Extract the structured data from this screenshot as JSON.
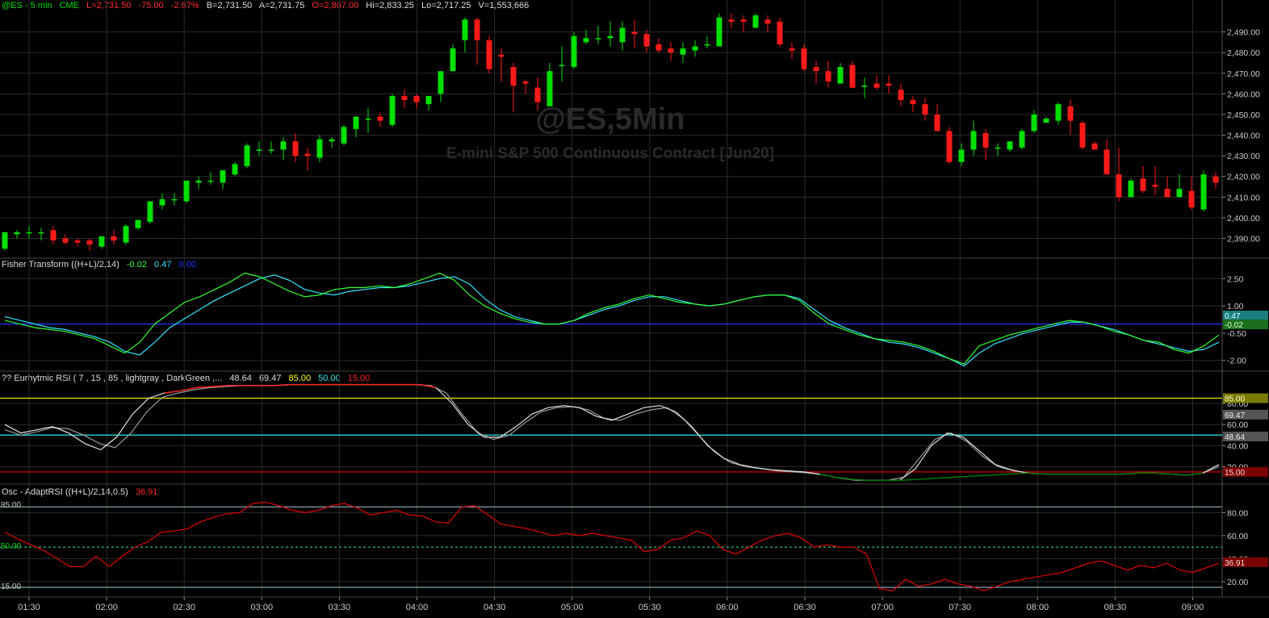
{
  "header": {
    "symbol": "@ES - 5 min",
    "exchange": "CME",
    "last": "L=2,731.50",
    "change": "-75.00",
    "change_pct": "-2.67%",
    "bid": "B=2,731.50",
    "ask": "A=2,731.75",
    "open": "O=2,807.00",
    "high": "Hi=2,833.25",
    "low": "Lo=2,717.25",
    "volume": "V=1,553,666"
  },
  "watermark": {
    "symbol": "@ES,5Min",
    "description": "E-mini S&P 500 Continuous Contract [Jun20]"
  },
  "panes": {
    "fisher": {
      "title": "Fisher Transform ((H+L)/2,14)",
      "v1": "-0.02",
      "v2": "0.47",
      "v3": "0.00"
    },
    "rsi": {
      "title": "?? Eurhytmic RSI ( 7 , 15 , 85 , lightgray , DarkGreen ,...",
      "v1": "48.64",
      "v2": "69.47",
      "v3": "85.00",
      "v4": "50.00",
      "v5": "15.00"
    },
    "osc": {
      "title": "Osc - AdaptRSI ((H+L)/2,14,0.5)",
      "v1": "36.91",
      "lvl_hi": "85.00",
      "lvl_mid": "50.00",
      "lvl_lo": "15.00"
    }
  },
  "colors": {
    "up": "#00e000",
    "down": "#ff1a1a",
    "fisher_a": "#33ff33",
    "fisher_b": "#33e6ff",
    "zero": "#2233ff",
    "rsi_fast": "#e0e0e0",
    "rsi_slow": "#9a9a9a",
    "rsi_red": "#ff1a1a",
    "rsi_green": "#007700",
    "band85": "#d6d600",
    "band50": "#33e6e6",
    "band15": "#c40000",
    "osc": "#e00000"
  },
  "chart_data": [
    {
      "type": "candlestick",
      "title": "@ES - 5 min",
      "x": [
        "01:30",
        "02:00",
        "02:30",
        "03:00",
        "03:30",
        "04:00",
        "04:30",
        "05:00",
        "05:30",
        "06:00",
        "06:30",
        "07:00",
        "07:30",
        "08:00",
        "08:30",
        "09:00"
      ],
      "ylim": [
        2382,
        2500
      ],
      "yticks": [
        2390,
        2400,
        2410,
        2420,
        2430,
        2440,
        2450,
        2460,
        2470,
        2480,
        2490
      ],
      "ytick_labels": [
        "2,390.00",
        "2,400.00",
        "2,410.00",
        "2,420.00",
        "2,430.00",
        "2,440.00",
        "2,450.00",
        "2,460.00",
        "2,470.00",
        "2,480.00",
        "2,490.00"
      ],
      "candles": [
        [
          2385,
          2393,
          2384,
          2393
        ],
        [
          2392,
          2394,
          2390,
          2393
        ],
        [
          2393,
          2396,
          2390,
          2393
        ],
        [
          2393,
          2395,
          2389,
          2393
        ],
        [
          2394,
          2396,
          2387,
          2389
        ],
        [
          2390,
          2392,
          2387,
          2388
        ],
        [
          2389,
          2390,
          2386,
          2388
        ],
        [
          2389,
          2390,
          2384,
          2387
        ],
        [
          2386,
          2391,
          2385,
          2391
        ],
        [
          2391,
          2394,
          2387,
          2389
        ],
        [
          2388,
          2397,
          2387,
          2396
        ],
        [
          2395,
          2399,
          2394,
          2399
        ],
        [
          2398,
          2408,
          2397,
          2408
        ],
        [
          2406,
          2412,
          2404,
          2409
        ],
        [
          2409,
          2412,
          2406,
          2409
        ],
        [
          2408,
          2418,
          2407,
          2418
        ],
        [
          2417,
          2420,
          2414,
          2418
        ],
        [
          2418,
          2422,
          2416,
          2418
        ],
        [
          2417,
          2423,
          2414,
          2423
        ],
        [
          2421,
          2427,
          2420,
          2426
        ],
        [
          2425,
          2436,
          2424,
          2435
        ],
        [
          2433,
          2437,
          2430,
          2433
        ],
        [
          2433,
          2437,
          2431,
          2433
        ],
        [
          2433,
          2439,
          2428,
          2437
        ],
        [
          2437,
          2441,
          2427,
          2430
        ],
        [
          2431,
          2434,
          2423,
          2430
        ],
        [
          2429,
          2440,
          2427,
          2438
        ],
        [
          2437,
          2439,
          2434,
          2438
        ],
        [
          2436,
          2445,
          2435,
          2444
        ],
        [
          2443,
          2448,
          2439,
          2449
        ],
        [
          2448,
          2453,
          2441,
          2448
        ],
        [
          2449,
          2451,
          2444,
          2447
        ],
        [
          2445,
          2460,
          2444,
          2459
        ],
        [
          2459,
          2462,
          2453,
          2457
        ],
        [
          2459,
          2460,
          2453,
          2456
        ],
        [
          2455,
          2459,
          2452,
          2459
        ],
        [
          2460,
          2471,
          2456,
          2471
        ],
        [
          2471,
          2484,
          2471,
          2482
        ],
        [
          2486,
          2497,
          2480,
          2496
        ],
        [
          2496,
          2497,
          2474,
          2486
        ],
        [
          2486,
          2488,
          2470,
          2472
        ],
        [
          2479,
          2482,
          2466,
          2478
        ],
        [
          2473,
          2475,
          2451,
          2464
        ],
        [
          2466,
          2467,
          2460,
          2465
        ],
        [
          2463,
          2468,
          2452,
          2456
        ],
        [
          2454,
          2475,
          2454,
          2471
        ],
        [
          2474,
          2483,
          2466,
          2474
        ],
        [
          2473,
          2490,
          2472,
          2488
        ],
        [
          2485,
          2491,
          2484,
          2487
        ],
        [
          2487,
          2493,
          2484,
          2487
        ],
        [
          2487,
          2495,
          2483,
          2488
        ],
        [
          2485,
          2495,
          2481,
          2492
        ],
        [
          2490,
          2496,
          2482,
          2489
        ],
        [
          2489,
          2491,
          2480,
          2483
        ],
        [
          2484,
          2487,
          2480,
          2481
        ],
        [
          2482,
          2485,
          2476,
          2480
        ],
        [
          2479,
          2485,
          2475,
          2482
        ],
        [
          2481,
          2486,
          2478,
          2483
        ],
        [
          2484,
          2488,
          2482,
          2484
        ],
        [
          2483,
          2499,
          2483,
          2497
        ],
        [
          2496,
          2499,
          2492,
          2495
        ],
        [
          2496,
          2498,
          2490,
          2495
        ],
        [
          2492,
          2499,
          2492,
          2498
        ],
        [
          2496,
          2498,
          2490,
          2494
        ],
        [
          2495,
          2497,
          2483,
          2484
        ],
        [
          2482,
          2485,
          2477,
          2481
        ],
        [
          2482,
          2484,
          2471,
          2472
        ],
        [
          2473,
          2476,
          2465,
          2471
        ],
        [
          2471,
          2476,
          2463,
          2466
        ],
        [
          2465,
          2475,
          2465,
          2473
        ],
        [
          2474,
          2476,
          2463,
          2463
        ],
        [
          2464,
          2468,
          2458,
          2464
        ],
        [
          2465,
          2469,
          2462,
          2463
        ],
        [
          2465,
          2469,
          2460,
          2464
        ],
        [
          2462,
          2465,
          2454,
          2457
        ],
        [
          2457,
          2459,
          2451,
          2455
        ],
        [
          2455,
          2458,
          2447,
          2450
        ],
        [
          2450,
          2455,
          2444,
          2442
        ],
        [
          2442,
          2444,
          2426,
          2427
        ],
        [
          2427,
          2436,
          2425,
          2433
        ],
        [
          2433,
          2447,
          2430,
          2442
        ],
        [
          2441,
          2443,
          2428,
          2434
        ],
        [
          2434,
          2436,
          2430,
          2434
        ],
        [
          2433,
          2437,
          2432,
          2437
        ],
        [
          2434,
          2443,
          2433,
          2442
        ],
        [
          2442,
          2452,
          2441,
          2450
        ],
        [
          2446,
          2449,
          2446,
          2448
        ],
        [
          2447,
          2456,
          2445,
          2455
        ],
        [
          2454,
          2457,
          2440,
          2447
        ],
        [
          2446,
          2447,
          2433,
          2434
        ],
        [
          2436,
          2437,
          2433,
          2433
        ],
        [
          2433,
          2438,
          2422,
          2421
        ],
        [
          2421,
          2434,
          2408,
          2410
        ],
        [
          2410,
          2419,
          2410,
          2418
        ],
        [
          2419,
          2425,
          2412,
          2413
        ],
        [
          2416,
          2425,
          2411,
          2415
        ],
        [
          2414,
          2420,
          2411,
          2410
        ],
        [
          2410,
          2421,
          2410,
          2414
        ],
        [
          2413,
          2420,
          2404,
          2405
        ],
        [
          2404,
          2423,
          2403,
          2421
        ],
        [
          2420,
          2422,
          2414,
          2417
        ]
      ]
    },
    {
      "type": "line",
      "title": "Fisher Transform ((H+L)/2,14)",
      "ylim": [
        -2.5,
        3.0
      ],
      "yticks": [
        2.5,
        1.0,
        -0.5,
        -2.0
      ],
      "ytick_labels": [
        "2.50",
        "1.00",
        "-0.50",
        "-2.00"
      ],
      "series": [
        {
          "name": "-0.02",
          "values": [
            0.2,
            0.0,
            -0.2,
            -0.3,
            -0.4,
            -0.6,
            -0.8,
            -1.2,
            -1.6,
            -1.0,
            0.0,
            0.6,
            1.2,
            1.5,
            1.9,
            2.3,
            2.8,
            2.6,
            2.2,
            1.8,
            1.5,
            1.6,
            1.9,
            2.0,
            2.0,
            2.1,
            2.0,
            2.2,
            2.5,
            2.8,
            2.4,
            1.6,
            1.0,
            0.6,
            0.3,
            0.1,
            0.0,
            0.0,
            0.2,
            0.6,
            0.9,
            1.1,
            1.4,
            1.6,
            1.4,
            1.2,
            1.1,
            1.0,
            1.1,
            1.3,
            1.5,
            1.6,
            1.6,
            1.3,
            0.6,
            0.0,
            -0.3,
            -0.6,
            -0.8,
            -0.9,
            -1.0,
            -1.2,
            -1.5,
            -1.9,
            -2.2,
            -1.2,
            -0.9,
            -0.6,
            -0.4,
            -0.2,
            0.0,
            0.2,
            0.1,
            -0.1,
            -0.4,
            -0.6,
            -0.9,
            -1.0,
            -1.4,
            -1.6,
            -1.2,
            -0.6
          ]
        },
        {
          "name": "0.47",
          "values": [
            0.4,
            0.2,
            0.0,
            -0.2,
            -0.3,
            -0.5,
            -0.7,
            -1.0,
            -1.5,
            -1.7,
            -1.0,
            -0.2,
            0.3,
            0.8,
            1.3,
            1.7,
            2.1,
            2.5,
            2.7,
            2.4,
            1.9,
            1.7,
            1.6,
            1.8,
            1.9,
            2.0,
            2.0,
            2.1,
            2.3,
            2.5,
            2.6,
            2.2,
            1.4,
            0.8,
            0.4,
            0.2,
            0.0,
            0.0,
            0.2,
            0.5,
            0.8,
            1.0,
            1.3,
            1.5,
            1.5,
            1.3,
            1.1,
            1.0,
            1.1,
            1.3,
            1.5,
            1.6,
            1.6,
            1.4,
            0.8,
            0.2,
            -0.2,
            -0.5,
            -0.8,
            -1.0,
            -1.1,
            -1.3,
            -1.6,
            -1.9,
            -2.3,
            -1.6,
            -1.1,
            -0.8,
            -0.5,
            -0.3,
            -0.1,
            0.1,
            0.1,
            -0.1,
            -0.3,
            -0.6,
            -0.9,
            -1.1,
            -1.3,
            -1.5,
            -1.4,
            -1.0
          ]
        }
      ],
      "zero_line": 0.0
    },
    {
      "type": "line",
      "title": "?? Eurhytmic RSI ( 7 , 15 , 85 , lightgray , DarkGreen ,...",
      "ylim": [
        5,
        100
      ],
      "yticks": [
        80,
        60,
        40,
        20
      ],
      "ytick_labels": [
        "80.00",
        "60.00",
        "40.00",
        "20.00"
      ],
      "levels": [
        85,
        50,
        15
      ],
      "series": [
        {
          "name": "48.64",
          "values": [
            60,
            52,
            55,
            58,
            52,
            42,
            36,
            48,
            70,
            85,
            90,
            92,
            95,
            96,
            97,
            97,
            97,
            97,
            98,
            98,
            98,
            98,
            98,
            98,
            98,
            98,
            98,
            95,
            80,
            60,
            48,
            48,
            58,
            70,
            76,
            78,
            76,
            68,
            64,
            70,
            76,
            78,
            72,
            58,
            40,
            28,
            22,
            19,
            17,
            16,
            15,
            13,
            10,
            8,
            7,
            7,
            7,
            18,
            40,
            52,
            48,
            35,
            22,
            17,
            14,
            13,
            13,
            13,
            13,
            13,
            13,
            14,
            14,
            13,
            12,
            14,
            22
          ]
        },
        {
          "name": "69.47",
          "values": [
            55,
            50,
            53,
            57,
            56,
            50,
            42,
            38,
            52,
            72,
            86,
            90,
            93,
            95,
            96,
            97,
            97,
            97,
            98,
            98,
            98,
            98,
            98,
            98,
            98,
            98,
            98,
            97,
            90,
            70,
            52,
            46,
            50,
            62,
            72,
            76,
            77,
            74,
            66,
            64,
            70,
            74,
            76,
            66,
            50,
            34,
            24,
            20,
            18,
            16,
            15,
            14,
            12,
            9,
            7,
            7,
            7,
            10,
            28,
            46,
            52,
            44,
            30,
            20,
            16,
            14,
            13,
            13,
            13,
            13,
            13,
            13,
            14,
            14,
            13,
            12,
            14,
            20
          ]
        }
      ]
    },
    {
      "type": "line",
      "title": "Osc - AdaptRSI ((H+L)/2,14,0.5)",
      "ylim": [
        8,
        95
      ],
      "yticks": [
        80,
        60,
        40,
        20
      ],
      "ytick_labels": [
        "80.00",
        "60.00",
        "40.00",
        "20.00"
      ],
      "levels": [
        85,
        50,
        15
      ],
      "series": [
        {
          "name": "36.91",
          "values": [
            63,
            57,
            52,
            47,
            40,
            33,
            33,
            42,
            33,
            42,
            50,
            55,
            63,
            64,
            66,
            72,
            76,
            79,
            80,
            88,
            89,
            86,
            82,
            80,
            82,
            86,
            88,
            84,
            78,
            80,
            82,
            78,
            77,
            72,
            71,
            85,
            86,
            78,
            70,
            68,
            66,
            63,
            60,
            62,
            60,
            62,
            60,
            58,
            56,
            46,
            48,
            56,
            58,
            64,
            60,
            48,
            44,
            50,
            56,
            60,
            62,
            58,
            50,
            52,
            50,
            50,
            44,
            14,
            12,
            22,
            16,
            18,
            22,
            18,
            16,
            12,
            16,
            20,
            22,
            24,
            26,
            28,
            32,
            36,
            38,
            34,
            30,
            34,
            32,
            36,
            30,
            28,
            32,
            36
          ]
        }
      ]
    }
  ]
}
